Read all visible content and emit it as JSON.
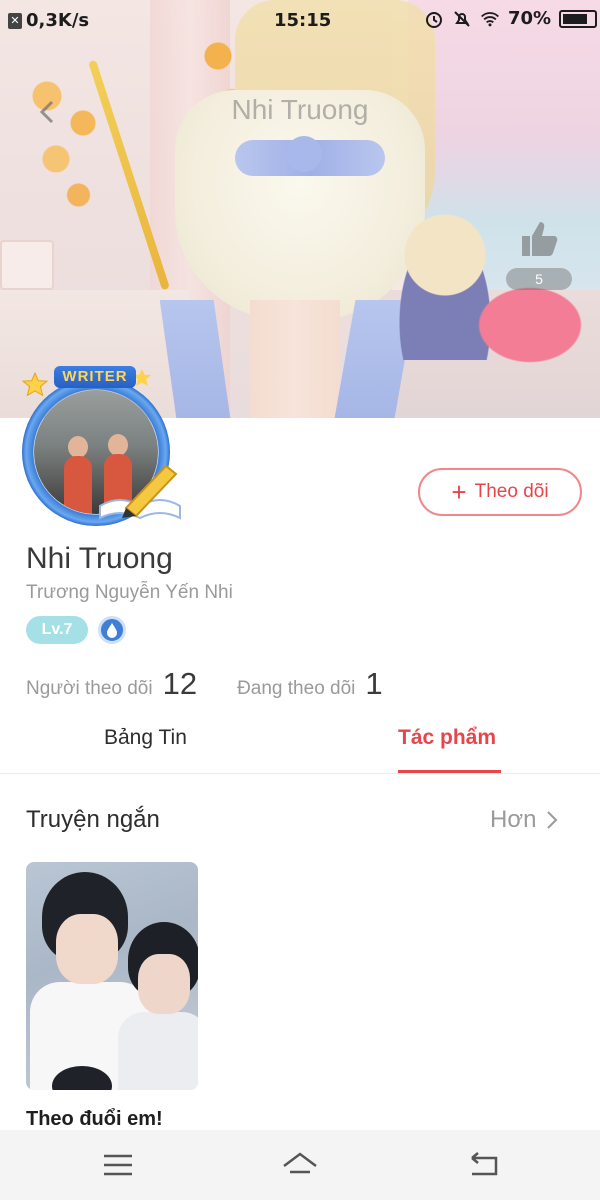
{
  "status_bar": {
    "net_speed": "0,3K/s",
    "time": "15:15",
    "battery": "70%",
    "icons": [
      "alarm-icon",
      "mute-bell-icon",
      "wifi-icon",
      "battery-icon"
    ]
  },
  "cover": {
    "title": "Nhi Truong",
    "like_count": "5",
    "icons": [
      "back-arrow-icon",
      "thumbs-up-icon"
    ]
  },
  "profile": {
    "badge": "WRITER",
    "name": "Nhi Truong",
    "full_name": "Trương Nguyễn Yến Nhi",
    "level": "Lv.7",
    "follow_button": "Theo dõi",
    "followers_label": "Người theo dõi",
    "followers_count": "12",
    "following_label": "Đang theo dõi",
    "following_count": "1"
  },
  "tabs": [
    {
      "label": "Bảng Tin",
      "active": false
    },
    {
      "label": "Tác phẩm",
      "active": true
    }
  ],
  "section": {
    "title": "Truyện ngắn",
    "more_label": "Hơn"
  },
  "stories": [
    {
      "title": "Theo đuổi em!"
    }
  ],
  "colors": {
    "accent": "#e8454b",
    "follow_border": "#f0888a",
    "level_badge": "#a6e0e7",
    "avatar_ring": "#3c7fd8"
  },
  "nav_bar": {
    "icons": [
      "menu-icon",
      "home-icon",
      "back-icon"
    ]
  }
}
